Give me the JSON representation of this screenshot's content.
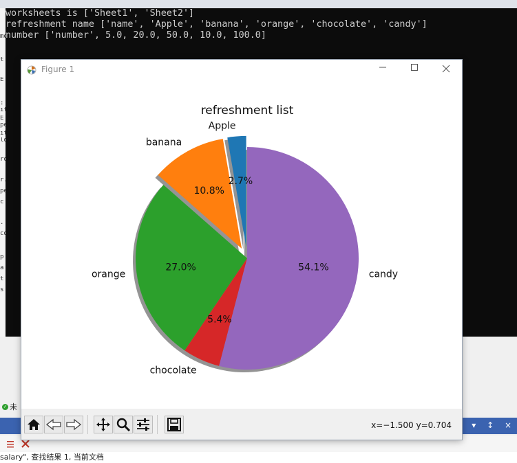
{
  "terminal": {
    "lines": [
      "worksheets is ['Sheet1', 'Sheet2']",
      "refreshment name ['name', 'Apple', 'banana', 'orange', 'chocolate', 'candy']",
      "number ['number', 5.0, 20.0, 50.0, 10.0, 100.0]"
    ]
  },
  "left_gutter": [
    "me",
    "t",
    "E",
    ":",
    "it",
    "E",
    "pe",
    "it",
    "lo",
    "ro",
    "r.",
    "pe",
    "c",
    ".",
    "co",
    "p",
    "a",
    "t",
    "s"
  ],
  "window": {
    "title": "Figure 1",
    "minimize_icon": "minimize-icon",
    "maximize_icon": "maximize-icon",
    "close_icon": "close-icon"
  },
  "chart_data": {
    "type": "pie",
    "title": "refreshment list",
    "labels": [
      "Apple",
      "banana",
      "orange",
      "chocolate",
      "candy"
    ],
    "values": [
      5.0,
      20.0,
      50.0,
      10.0,
      100.0
    ],
    "percent_labels": [
      "2.7%",
      "10.8%",
      "27.0%",
      "5.4%",
      "54.1%"
    ],
    "colors": [
      "#1f77b4",
      "#ff7f0e",
      "#2ca02c",
      "#d62728",
      "#9467bd"
    ],
    "explode": [
      0.1,
      0.1,
      0,
      0,
      0
    ],
    "shadow": true,
    "start_angle": 90,
    "direction": "counterclockwise",
    "legend": "none"
  },
  "toolbar": {
    "buttons": [
      {
        "icon": "home-icon"
      },
      {
        "icon": "back-arrow-icon"
      },
      {
        "icon": "forward-arrow-icon"
      },
      {
        "icon": "pan-move-icon"
      },
      {
        "icon": "zoom-magnifier-icon"
      },
      {
        "icon": "configure-subplots-icon"
      },
      {
        "icon": "save-floppy-icon"
      }
    ],
    "coords": "x=−1.500 y=0.704"
  },
  "status": {
    "left_fragment": "未"
  },
  "bottom_panel": {
    "search_result": "salary\", 查找结果 1, 当前文档",
    "right_controls": "▾ ↕ ×"
  }
}
